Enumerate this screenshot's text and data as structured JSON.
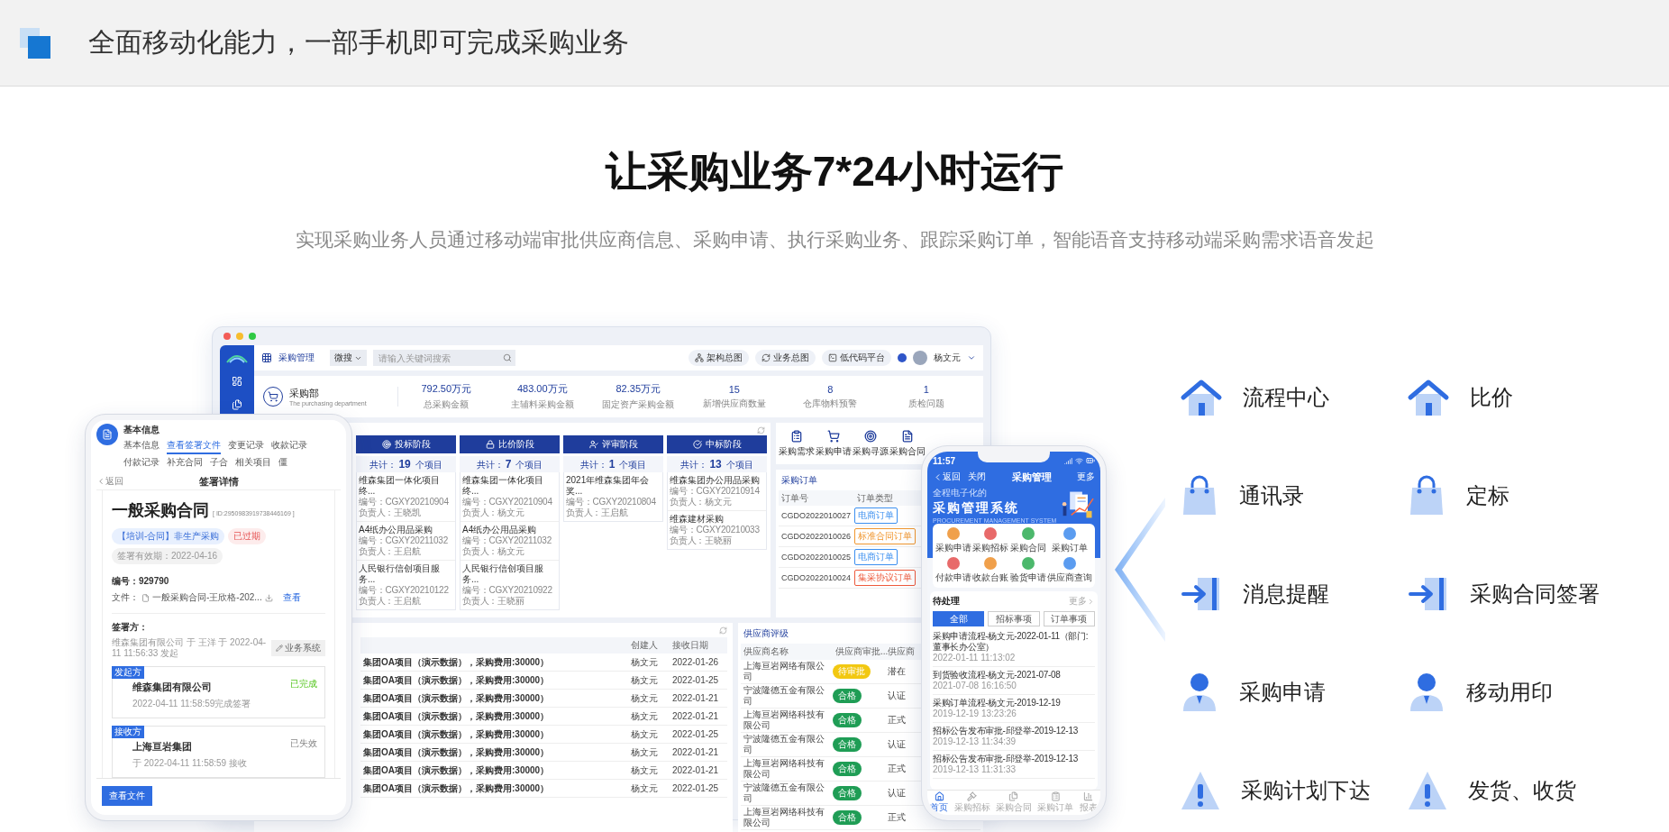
{
  "header": {
    "title": "全面移动化能力，一部手机即可完成采购业务"
  },
  "hero": {
    "title": "让采购业务7*24小时运行",
    "subtitle": "实现采购业务人员通过移动端审批供应商信息、采购申请、执行采购业务、跟踪采购订单，智能语音支持移动端采购需求语音发起"
  },
  "desktop": {
    "app_name": "采购管理",
    "search": {
      "scope": "微搜",
      "placeholder": "请输入关键词搜索"
    },
    "toolbar_buttons": [
      {
        "label": "架构总图",
        "kind": "org"
      },
      {
        "label": "业务总图",
        "kind": "cycle"
      },
      {
        "label": "低代码平台",
        "kind": "code"
      }
    ],
    "user": "杨文元",
    "department": {
      "name": "采购部",
      "subtitle": "The purchasing department"
    },
    "stats": [
      {
        "value": "792.50万元",
        "label": "总采购金额"
      },
      {
        "value": "483.00万元",
        "label": "主辅料采购金额"
      },
      {
        "value": "82.35万元",
        "label": "固定资产采购金额"
      },
      {
        "value": "15",
        "label": "新增供应商数量"
      },
      {
        "value": "8",
        "label": "仓库物料预警"
      },
      {
        "value": "1",
        "label": "质检问题"
      }
    ],
    "stages": [
      {
        "name": "投标阶段",
        "kind": "target",
        "count": "共计：**19** 个项目",
        "items": [
          {
            "title": "维森集团一体化项目终...",
            "code": "编号：CGXY20210904",
            "owner": "负责人：王晓凯"
          },
          {
            "title": "A4纸办公用品采购",
            "code": "编号：CGXY20211032",
            "owner": "负责人：王启航"
          },
          {
            "title": "人民银行信创项目服务...",
            "code": "编号：CGXY20210122",
            "owner": "负责人：王启航"
          }
        ]
      },
      {
        "name": "比价阶段",
        "kind": "lock",
        "count": "共计：**7** 个项目",
        "items": [
          {
            "title": "维森集团一体化项目终...",
            "code": "编号：CGXY20210904",
            "owner": "负责人：杨文元"
          },
          {
            "title": "A4纸办公用品采购",
            "code": "编号：CGXY20211032",
            "owner": "负责人：杨文元"
          },
          {
            "title": "人民银行信创项目服务...",
            "code": "编号：CGXY20210922",
            "owner": "负责人：王晓丽"
          }
        ]
      },
      {
        "name": "评审阶段",
        "kind": "user",
        "count": "共计：**1** 个项目",
        "items": [
          {
            "title": "2021年维森集团年会奖...",
            "code": "编号：CGXY20210804",
            "owner": "负责人：王启航"
          }
        ]
      },
      {
        "name": "中标阶段",
        "kind": "check",
        "count": "共计：**13** 个项目",
        "items": [
          {
            "title": "维森集团办公用品采购",
            "code": "编号：CGXY20210914",
            "owner": "负责人：杨文元"
          },
          {
            "title": "维森建材采购",
            "code": "编号：CGXY20210033",
            "owner": "负责人：王晓丽"
          }
        ]
      }
    ],
    "quick_links": [
      {
        "label": "采购需求",
        "kind": "clipboard"
      },
      {
        "label": "采购申请",
        "kind": "cart"
      },
      {
        "label": "采购寻源",
        "kind": "target"
      },
      {
        "label": "采购合同",
        "kind": "doc"
      }
    ],
    "orders": {
      "title": "采购订单",
      "columns": [
        "订单号",
        "订单类型"
      ],
      "rows": [
        {
          "code": "CGDO2022010027",
          "type": "电商订单",
          "color": "#3b8ff0"
        },
        {
          "code": "CGDO2022010026",
          "type": "标准合同订单",
          "color": "#f0962e"
        },
        {
          "code": "CGDO2022010025",
          "type": "电商订单",
          "color": "#3b8ff0"
        },
        {
          "code": "CGDO2022010024",
          "type": "集采协议订单",
          "color": "#ee5a3c"
        }
      ]
    },
    "projects": {
      "columns": [
        "创建人",
        "接收日期"
      ],
      "rows": [
        {
          "title": "集团OA项目（演示数据），采购费用:30000）",
          "creator": "杨文元",
          "date": "2022-01-26"
        },
        {
          "title": "集团OA项目（演示数据），采购费用:30000）",
          "creator": "杨文元",
          "date": "2022-01-25"
        },
        {
          "title": "集团OA项目（演示数据），采购费用:30000）",
          "creator": "杨文元",
          "date": "2022-01-21"
        },
        {
          "title": "集团OA项目（演示数据），采购费用:30000）",
          "creator": "杨文元",
          "date": "2022-01-21"
        },
        {
          "title": "集团OA项目（演示数据），采购费用:30000）",
          "creator": "杨文元",
          "date": "2022-01-25"
        },
        {
          "title": "集团OA项目（演示数据），采购费用:30000）",
          "creator": "杨文元",
          "date": "2022-01-21"
        },
        {
          "title": "集团OA项目（演示数据），采购费用:30000）",
          "creator": "杨文元",
          "date": "2022-01-21"
        },
        {
          "title": "集团OA项目（演示数据），采购费用:30000）",
          "creator": "杨文元",
          "date": "2022-01-25"
        }
      ]
    },
    "suppliers": {
      "title": "供应商评级",
      "columns": [
        "供应商名称",
        "供应商审批...",
        "供应商"
      ],
      "rows": [
        {
          "name": "上海亘岩网络有限公司",
          "approval": "待审批",
          "color": "#f2c811",
          "level": "潜在"
        },
        {
          "name": "宁波隆德五金有限公司",
          "approval": "合格",
          "color": "#1f9d55",
          "level": "认证"
        },
        {
          "name": "上海亘岩网络科技有限公司",
          "approval": "合格",
          "color": "#1f9d55",
          "level": "正式"
        },
        {
          "name": "宁波隆德五金有限公司",
          "approval": "合格",
          "color": "#1f9d55",
          "level": "认证"
        },
        {
          "name": "上海亘岩网络科技有限公司",
          "approval": "合格",
          "color": "#1f9d55",
          "level": "正式"
        },
        {
          "name": "宁波隆德五金有限公司",
          "approval": "合格",
          "color": "#1f9d55",
          "level": "认证"
        },
        {
          "name": "上海亘岩网络科技有限公司",
          "approval": "合格",
          "color": "#1f9d55",
          "level": "正式"
        }
      ]
    }
  },
  "tablet": {
    "section": "基本信息",
    "tabs": [
      {
        "label": "基本信息",
        "selected": false
      },
      {
        "label": "查看签署文件",
        "selected": true
      },
      {
        "label": "变更记录",
        "selected": false
      },
      {
        "label": "收款记录",
        "selected": false
      },
      {
        "label": "付款记录",
        "selected": false
      },
      {
        "label": "补充合同",
        "selected": false
      },
      {
        "label": "子合",
        "selected": false
      },
      {
        "label": "相关项目",
        "selected": false
      },
      {
        "label": "僵",
        "selected": false
      }
    ],
    "back": "返回",
    "page_title": "签署详情",
    "contract": {
      "title": "一般采购合同",
      "id": "[ ID:2950983919738446169 ]",
      "tags": [
        {
          "label": "【培训-合同】非生产采购",
          "kind": "category"
        },
        {
          "label": "已过期",
          "kind": "expired"
        },
        {
          "label": "签署有效期：2022-04-16",
          "kind": "validity"
        }
      ],
      "number": "编号：929790",
      "file_label": "文件：",
      "file_name": "一般采购合同-王欣格-202...",
      "file_link": "查看"
    },
    "signers_label": "签署方：",
    "initiation": "维森集团有限公司 于 王洋 于 2022-04-11 11:56:33 发起",
    "system_button": "业务系统",
    "signers": [
      {
        "role": "发起方",
        "name": "维森集团有限公司",
        "note": "2022-04-11 11:58:59完成签署",
        "status": "已完成",
        "done": true
      },
      {
        "role": "接收方",
        "name": "上海亘岩集团",
        "note": "于 2022-04-11 11:58:59 接收",
        "status": "已失效",
        "done": false
      }
    ],
    "view_button": "查看文件"
  },
  "phone": {
    "time": "11:57",
    "back": "返回",
    "close": "关闭",
    "title": "采购管理",
    "more": "更多",
    "banner": {
      "kicker": "全程电子化的",
      "title": "采购管理系统",
      "subtitle": "PROCUREMENT MANAGEMENT SYSTEM"
    },
    "apps": [
      {
        "label": "采购申请",
        "color": "#f0a04b"
      },
      {
        "label": "采购招标",
        "color": "#e86a6a"
      },
      {
        "label": "采购合同",
        "color": "#4cb86c"
      },
      {
        "label": "采购订单",
        "color": "#5b9cf0"
      },
      {
        "label": "付款申请",
        "color": "#e86a6a"
      },
      {
        "label": "收款台账",
        "color": "#f0a04b"
      },
      {
        "label": "验货申请",
        "color": "#4cb86c"
      },
      {
        "label": "供应商查询",
        "color": "#5b9cf0"
      }
    ],
    "todo": {
      "title": "待处理",
      "more": "更多",
      "tabs": [
        {
          "label": "全部",
          "selected": true
        },
        {
          "label": "招标事项",
          "selected": false
        },
        {
          "label": "订单事项",
          "selected": false
        }
      ],
      "items": [
        {
          "title": "采购申请流程-杨文元-2022-01-11（部门:董事长办公室）",
          "time": "2022-01-11 11:13:02"
        },
        {
          "title": "到货验收流程-杨文元-2021-07-08",
          "time": "2021-07-08 16:16:50"
        },
        {
          "title": "采购订单流程-杨文元-2019-12-19",
          "time": "2019-12-19 13:23:26"
        },
        {
          "title": "招标公告发布审批-邱登举-2019-12-13",
          "time": "2019-12-13 11:34:39"
        },
        {
          "title": "招标公告发布审批-邱登举-2019-12-13",
          "time": "2019-12-13 11:31:33"
        }
      ]
    },
    "nav": [
      {
        "label": "首页",
        "kind": "home",
        "selected": true
      },
      {
        "label": "采购招标",
        "kind": "gavel",
        "selected": false
      },
      {
        "label": "采购合同",
        "kind": "contract",
        "selected": false
      },
      {
        "label": "采购订单",
        "kind": "order",
        "selected": false
      },
      {
        "label": "报表",
        "kind": "chart",
        "selected": false
      }
    ]
  },
  "features": [
    {
      "label": "流程中心",
      "kind": "home"
    },
    {
      "label": "比价",
      "kind": "home"
    },
    {
      "label": "通讯录",
      "kind": "bag"
    },
    {
      "label": "定标",
      "kind": "bag"
    },
    {
      "label": "消息提醒",
      "kind": "enter"
    },
    {
      "label": "采购合同签署",
      "kind": "enter"
    },
    {
      "label": "采购申请",
      "kind": "user"
    },
    {
      "label": "移动用印",
      "kind": "user"
    },
    {
      "label": "采购计划下达",
      "kind": "alert"
    },
    {
      "label": "发货、收货",
      "kind": "alert"
    }
  ]
}
